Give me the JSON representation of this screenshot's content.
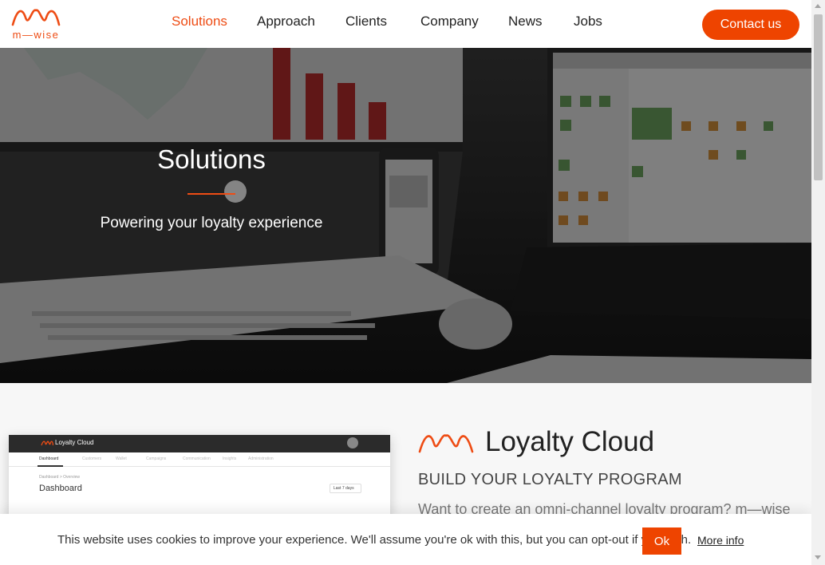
{
  "header": {
    "logo_text": "m—wise",
    "nav": [
      {
        "label": "Solutions",
        "active": true
      },
      {
        "label": "Approach",
        "active": false
      },
      {
        "label": "Clients",
        "active": false
      },
      {
        "label": "Company",
        "active": false
      },
      {
        "label": "News",
        "active": false
      },
      {
        "label": "Jobs",
        "active": false
      }
    ],
    "contact_label": "Contact us"
  },
  "hero": {
    "title": "Solutions",
    "subtitle": "Powering your loyalty experience"
  },
  "product": {
    "title": "Loyalty Cloud",
    "subtitle": "BUILD YOUR LOYALTY PROGRAM",
    "text": "Want to create an omni-channel loyalty program? m—wise",
    "dashboard": {
      "brand": "Loyalty Cloud",
      "tabs": [
        "Dashboard",
        "Customers",
        "Wallet",
        "Campaigns",
        "Communication",
        "Insights",
        "Administration"
      ],
      "breadcrumb": "Dashboard  >  Overview",
      "title": "Dashboard",
      "range": "Last 7 days"
    }
  },
  "cookie": {
    "text": "This website uses cookies to improve your experience. We'll assume you're ok with this, but you can opt-out if you wish.",
    "ok_label": "Ok",
    "more_label": "More info"
  },
  "colors": {
    "accent": "#ee4400",
    "nav_active": "#ee4c14"
  }
}
